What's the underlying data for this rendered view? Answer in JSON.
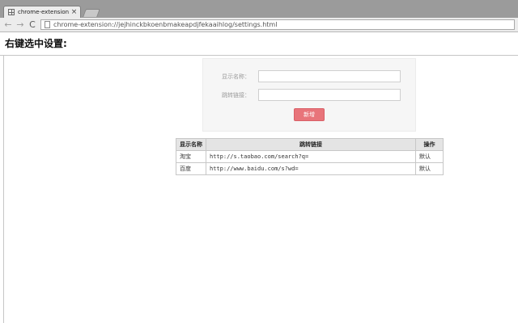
{
  "browser": {
    "tab_title": "chrome-extension://jej",
    "tab_close": "×",
    "nav": {
      "back": "←",
      "forward": "→",
      "reload": "C"
    },
    "url": "chrome-extension://jejhinckbkoenbmakeapdjfekaaihlog/settings.html"
  },
  "page": {
    "title": "右键选中设置:"
  },
  "form": {
    "name_label": "显示名称：",
    "name_value": "",
    "url_label": "跳转链接：",
    "url_value": "",
    "add_button": "新增",
    "button_color": "#e8747a"
  },
  "table": {
    "headers": [
      "显示名称",
      "跳转链接",
      "操作"
    ],
    "rows": [
      {
        "name": "淘宝",
        "link": "http://s.taobao.com/search?q=",
        "action": "默认"
      },
      {
        "name": "百度",
        "link": "http://www.baidu.com/s?wd=",
        "action": "默认"
      }
    ]
  },
  "colors": {
    "tabstrip": "#9b9b9b",
    "toolbar": "#ececec",
    "panel": "#f6f6f6",
    "header_row": "#e4e4e4"
  }
}
